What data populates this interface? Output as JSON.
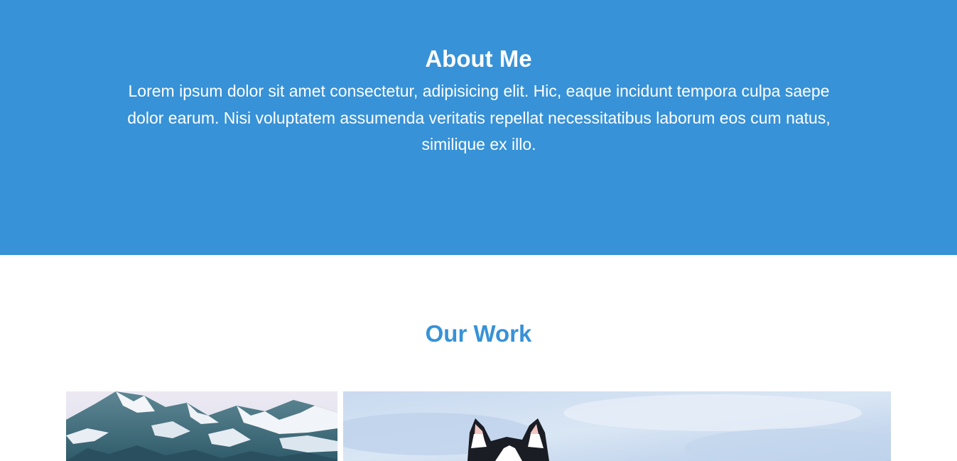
{
  "about": {
    "title": "About Me",
    "body": "Lorem ipsum dolor sit amet consectetur, adipisicing elit. Hic, eaque incidunt tempora culpa saepe dolor earum. Nisi voluptatem assumenda veritatis repellat necessitatibus laborum eos cum natus, similique ex illo."
  },
  "work": {
    "title": "Our Work",
    "photos": [
      {
        "subject": "snowy-mountain"
      },
      {
        "subject": "husky-dog"
      }
    ]
  },
  "colors": {
    "accent": "#3792d7",
    "background": "#ffffff",
    "about_text": "#ffffff"
  }
}
